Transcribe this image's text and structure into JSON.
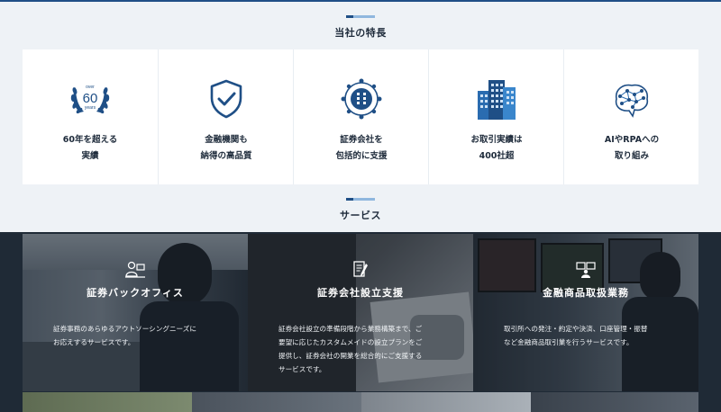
{
  "features_section": {
    "title": "当社の特長",
    "items": [
      {
        "line1": "60年を超える",
        "line2": "実績",
        "icon": "laurel-wreath-icon",
        "badge_top": "over",
        "badge_num": "60",
        "badge_bottom": "years"
      },
      {
        "line1": "金融機関も",
        "line2": "納得の高品質",
        "icon": "shield-check-icon"
      },
      {
        "line1": "証券会社を",
        "line2": "包括的に支援",
        "icon": "building-network-icon"
      },
      {
        "line1": "お取引実績は",
        "line2": "400社超",
        "icon": "office-buildings-icon"
      },
      {
        "line1": "AIやRPAへの",
        "line2": "取り組み",
        "icon": "ai-brain-icon"
      }
    ]
  },
  "services_section": {
    "title": "サービス",
    "items": [
      {
        "title": "証券バックオフィス",
        "icon": "operator-desk-icon",
        "desc1": "証券事務のあらゆるアウトソーシングニーズに",
        "desc2": "お応えするサービスです。"
      },
      {
        "title": "証券会社設立支援",
        "icon": "document-pen-icon",
        "desc1": "証券会社設立の準備段階から業務構築まで、ご",
        "desc2": "要望に応じたカスタムメイドの設立プランをご",
        "desc3": "提供し、証券会社の開業を総合的にご支援する",
        "desc4": "サービスです。"
      },
      {
        "title": "金融商品取扱業務",
        "icon": "trading-monitors-icon",
        "desc1": "取引所への発注・約定や決済、口座管理・振替",
        "desc2": "など金融商品取引業を行うサービスです。"
      }
    ]
  },
  "colors": {
    "accent": "#1f4f86",
    "accent_light": "#8fb7de",
    "background": "#eef2f6",
    "dark": "#1f2a36"
  }
}
